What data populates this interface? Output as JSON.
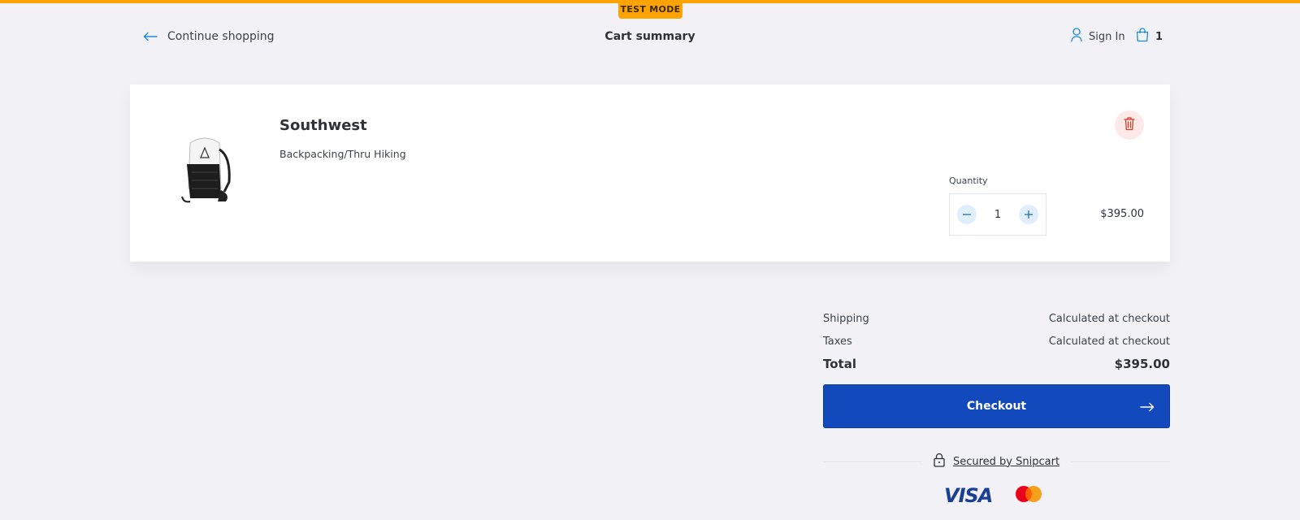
{
  "banner": {
    "test_mode": "TEST MODE"
  },
  "header": {
    "back_label": "Continue shopping",
    "title": "Cart summary",
    "signin_label": "Sign In",
    "cart_count": "1"
  },
  "cart": {
    "items": [
      {
        "name": "Southwest",
        "description": "Backpacking/Thru Hiking",
        "quantity_label": "Quantity",
        "quantity": "1",
        "price": "$395.00"
      }
    ]
  },
  "summary": {
    "shipping_label": "Shipping",
    "shipping_value": "Calculated at checkout",
    "taxes_label": "Taxes",
    "taxes_value": "Calculated at checkout",
    "total_label": "Total",
    "total_value": "$395.00"
  },
  "checkout": {
    "label": "Checkout"
  },
  "secured": {
    "label": "Secured by Snipcart"
  },
  "payment": {
    "visa_label": "VISA"
  },
  "colors": {
    "accent_orange": "#ffa300",
    "primary_blue": "#1249bc",
    "delete_bg": "#fde9e7",
    "delete_icon": "#d0402b",
    "qty_btn_bg": "#e1eefd",
    "link_blue": "#1a8dd6"
  },
  "icons": {
    "back": "arrow-left-icon",
    "signin": "user-icon",
    "cart": "shopping-bag-icon",
    "delete": "trash-icon",
    "decrement": "minus-icon",
    "increment": "plus-icon",
    "checkout": "arrow-right-icon",
    "secured": "lock-icon",
    "visa": "visa-logo",
    "mastercard": "mastercard-logo"
  }
}
